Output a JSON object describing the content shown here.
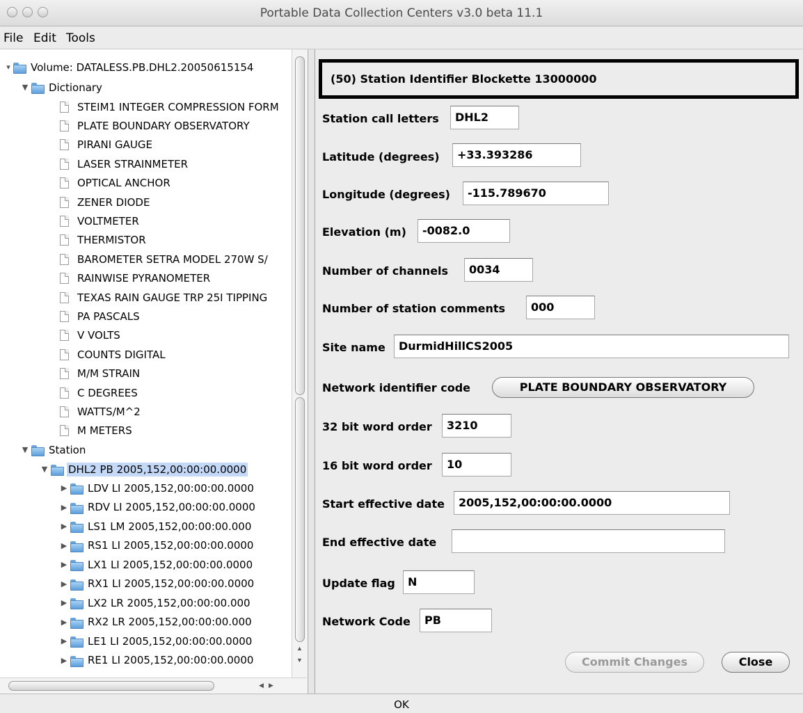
{
  "window": {
    "title": "Portable Data Collection Centers v3.0 beta 11.1"
  },
  "menu": {
    "items": [
      "File",
      "Edit",
      "Tools"
    ]
  },
  "tree": {
    "volume": "Volume: DATALESS.PB.DHL2.20050615154",
    "dictionary": "Dictionary",
    "dictionary_items": [
      "STEIM1 INTEGER COMPRESSION FORM",
      "PLATE BOUNDARY OBSERVATORY",
      "PIRANI GAUGE",
      "LASER STRAINMETER",
      "OPTICAL ANCHOR",
      "ZENER DIODE",
      "VOLTMETER",
      "THERMISTOR",
      "BAROMETER SETRA MODEL 270W S/",
      "RAINWISE PYRANOMETER",
      "TEXAS RAIN GAUGE TRP 25I TIPPING",
      "PA PASCALS",
      "V VOLTS",
      "COUNTS DIGITAL",
      "M/M STRAIN",
      "C DEGREES",
      "WATTS/M^2",
      "M METERS"
    ],
    "station": "Station",
    "station_node": "DHL2 PB 2005,152,00:00:00.0000",
    "channels": [
      "LDV LI 2005,152,00:00:00.0000",
      "RDV LI 2005,152,00:00:00.0000",
      "LS1 LM 2005,152,00:00:00.000",
      "RS1 LI 2005,152,00:00:00.0000",
      "LX1 LI 2005,152,00:00:00.0000",
      "RX1 LI 2005,152,00:00:00.0000",
      "LX2 LR 2005,152,00:00:00.000",
      "RX2 LR 2005,152,00:00:00.000",
      "LE1 LI 2005,152,00:00:00.0000",
      "RE1 LI 2005,152,00:00:00.0000"
    ]
  },
  "form": {
    "title": "(50) Station Identifier Blockette 13000000",
    "fields": [
      {
        "label": "Station call letters",
        "value": "DHL2"
      },
      {
        "label": "Latitude (degrees)",
        "value": "+33.393286"
      },
      {
        "label": "Longitude (degrees)",
        "value": "-115.789670"
      },
      {
        "label": "Elevation (m)",
        "value": "-0082.0"
      },
      {
        "label": "Number of channels",
        "value": "0034"
      },
      {
        "label": "Number of station comments",
        "value": "000"
      },
      {
        "label": "Site name",
        "value": "DurmidHillCS2005"
      },
      {
        "label": "Network identifier code",
        "value": "PLATE BOUNDARY OBSERVATORY"
      },
      {
        "label": "32 bit word order",
        "value": "3210"
      },
      {
        "label": "16 bit word order",
        "value": "10"
      },
      {
        "label": "Start effective date",
        "value": "2005,152,00:00:00.0000"
      },
      {
        "label": "End effective date",
        "value": ""
      },
      {
        "label": "Update flag",
        "value": "N"
      },
      {
        "label": "Network Code",
        "value": "PB"
      }
    ],
    "commit_label": "Commit Changes",
    "close_label": "Close"
  },
  "status": {
    "text": "OK"
  }
}
